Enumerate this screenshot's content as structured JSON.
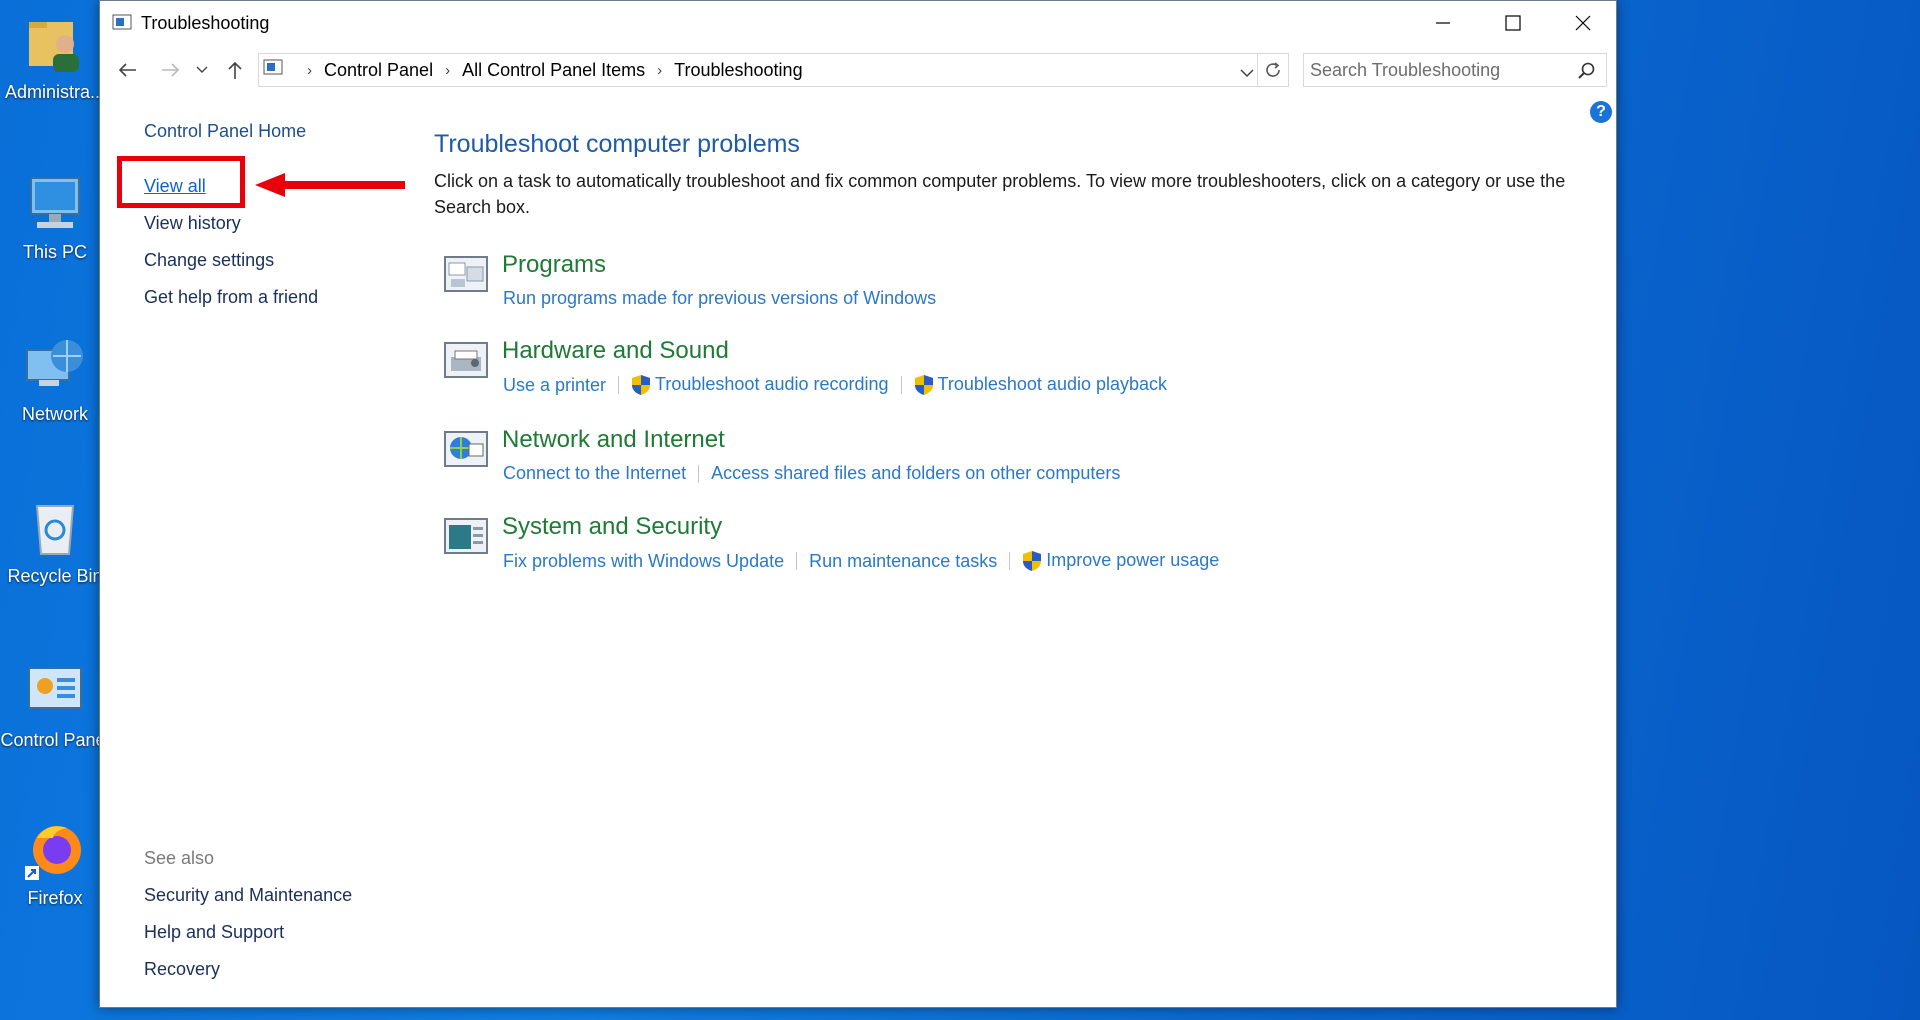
{
  "desktop": {
    "icons": [
      {
        "label": "Administra...",
        "icon": "user-folder-icon"
      },
      {
        "label": "This PC",
        "icon": "computer-icon"
      },
      {
        "label": "Network",
        "icon": "network-globe-icon"
      },
      {
        "label": "Recycle Bin",
        "icon": "recycle-bin-icon"
      },
      {
        "label": "Control Panel",
        "icon": "control-panel-icon"
      },
      {
        "label": "Firefox",
        "icon": "firefox-icon"
      }
    ]
  },
  "window": {
    "title": "Troubleshooting",
    "breadcrumb": [
      "Control Panel",
      "All Control Panel Items",
      "Troubleshooting"
    ],
    "search_placeholder": "Search Troubleshooting"
  },
  "left_pane": {
    "home": "Control Panel Home",
    "links": [
      "View all",
      "View history",
      "Change settings",
      "Get help from a friend"
    ],
    "see_also_heading": "See also",
    "see_also": [
      "Security and Maintenance",
      "Help and Support",
      "Recovery"
    ]
  },
  "main": {
    "title": "Troubleshoot computer problems",
    "description": "Click on a task to automatically troubleshoot and fix common computer problems. To view more troubleshooters, click on a category or use the Search box.",
    "categories": [
      {
        "name": "Programs",
        "icon": "programs-icon",
        "links": [
          {
            "text": "Run programs made for previous versions of Windows",
            "shield": false
          }
        ]
      },
      {
        "name": "Hardware and Sound",
        "icon": "hardware-sound-icon",
        "links": [
          {
            "text": "Use a printer",
            "shield": false
          },
          {
            "text": "Troubleshoot audio recording",
            "shield": true
          },
          {
            "text": "Troubleshoot audio playback",
            "shield": true
          }
        ]
      },
      {
        "name": "Network and Internet",
        "icon": "network-internet-icon",
        "links": [
          {
            "text": "Connect to the Internet",
            "shield": false
          },
          {
            "text": "Access shared files and folders on other computers",
            "shield": false
          }
        ]
      },
      {
        "name": "System and Security",
        "icon": "system-security-icon",
        "links": [
          {
            "text": "Fix problems with Windows Update",
            "shield": false
          },
          {
            "text": "Run maintenance tasks",
            "shield": false
          },
          {
            "text": "Improve power usage",
            "shield": true
          }
        ]
      }
    ]
  },
  "colors": {
    "desktop_bg": "#0a6fd8",
    "highlight": "#e8000b",
    "category_green": "#1e7a34",
    "link_blue": "#2a78c9"
  }
}
